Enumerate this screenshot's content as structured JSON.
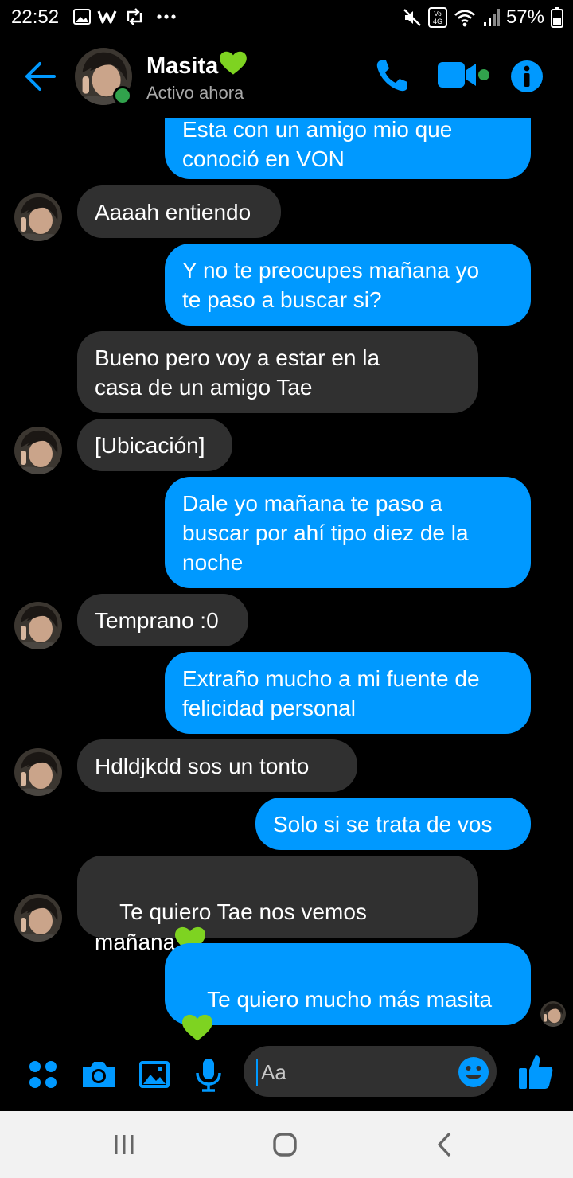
{
  "status_bar": {
    "time": "22:52",
    "battery_pct": "57%",
    "left_icons": [
      "gallery-icon",
      "w-app-icon",
      "repost-icon",
      "more-dots-icon"
    ],
    "right_icons": [
      "mute-icon",
      "volte-4g-icon",
      "wifi-icon",
      "signal-icon",
      "battery-icon"
    ]
  },
  "header": {
    "contact_name": "Masita",
    "status": "Activo ahora",
    "online": true
  },
  "messages": [
    {
      "dir": "out",
      "text": "Esta con un amigo mio que\nconoció en VON"
    },
    {
      "dir": "in",
      "text": "Aaaah entiendo",
      "avatar": true
    },
    {
      "dir": "out",
      "text": "Y no te preocupes mañana yo\nte paso a buscar si?"
    },
    {
      "dir": "in",
      "text": "Bueno pero voy a estar en la\ncasa de un amigo Tae",
      "avatar": false
    },
    {
      "dir": "in",
      "text": "[Ubicación]",
      "avatar": true
    },
    {
      "dir": "out",
      "text": "Dale yo mañana te paso a\nbuscar por ahí tipo diez de la\nnoche"
    },
    {
      "dir": "in",
      "text": "Temprano :0",
      "avatar": true
    },
    {
      "dir": "out",
      "text": "Extraño mucho a mi fuente de\nfelicidad personal"
    },
    {
      "dir": "in",
      "text": "Hdldjkdd sos un tonto",
      "avatar": true
    },
    {
      "dir": "out",
      "text": "Solo si se trata de vos"
    },
    {
      "dir": "in",
      "text": "Te quiero Tae nos vemos\nmañana",
      "avatar": true,
      "heart": true
    },
    {
      "dir": "out",
      "text": "Te quiero mucho más masita\n",
      "heart": true,
      "seen": true
    }
  ],
  "composer": {
    "placeholder": "Aa",
    "icons": [
      "apps-icon",
      "camera-icon",
      "gallery-icon",
      "microphone-icon",
      "emoji-icon",
      "thumbs-up-icon"
    ]
  },
  "colors": {
    "accent": "#0099ff",
    "incoming_bubble": "#303030",
    "online": "#31a24c",
    "heart": "#7ed321",
    "background": "#000000"
  }
}
